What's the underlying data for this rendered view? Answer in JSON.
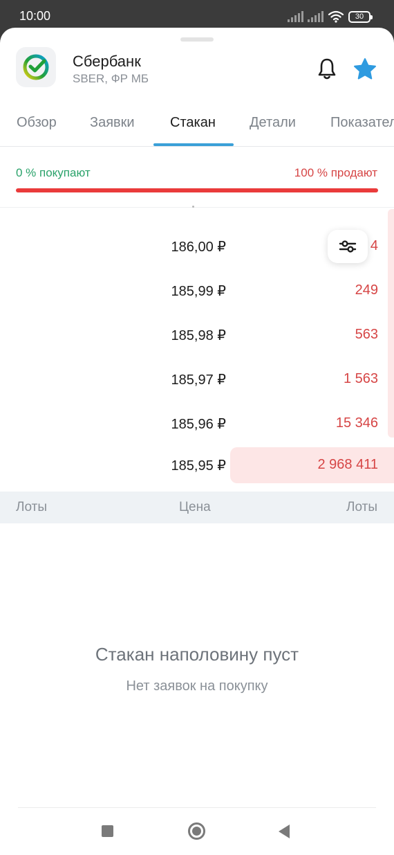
{
  "status_bar": {
    "time": "10:00",
    "battery": "30"
  },
  "instrument": {
    "name": "Сбербанк",
    "subtitle": "SBER, ФР МБ"
  },
  "tabs": [
    {
      "label": "Обзор"
    },
    {
      "label": "Заявки"
    },
    {
      "label": "Стакан",
      "active": true
    },
    {
      "label": "Детали"
    },
    {
      "label": "Показател"
    }
  ],
  "ratio": {
    "buy_label": "0 % покупают",
    "sell_label": "100 % продают",
    "buy_percent": 0,
    "sell_percent": 100
  },
  "order_book": {
    "asks": [
      {
        "price": "186,00 ₽",
        "lots": "4"
      },
      {
        "price": "185,99 ₽",
        "lots": "249"
      },
      {
        "price": "185,98 ₽",
        "lots": "563"
      },
      {
        "price": "185,97 ₽",
        "lots": "1 563"
      },
      {
        "price": "185,96 ₽",
        "lots": "15 346"
      },
      {
        "price": "185,95 ₽",
        "lots": "2 968 411"
      }
    ],
    "columns": {
      "left": "Лоты",
      "center": "Цена",
      "right": "Лоты"
    }
  },
  "empty_state": {
    "title": "Стакан наполовину пуст",
    "subtitle": "Нет заявок на покупку"
  },
  "colors": {
    "buy": "#2aa26a",
    "sell": "#d64545",
    "accent": "#3aa0d8",
    "star": "#2f9be0"
  },
  "icons": [
    "sber-logo-icon",
    "bell-icon",
    "star-icon",
    "filter-icon",
    "wifi-icon",
    "signal-icon",
    "battery-icon"
  ]
}
